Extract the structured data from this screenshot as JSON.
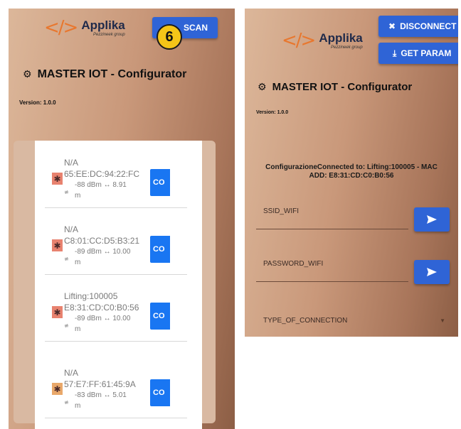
{
  "left_screen": {
    "logo": {
      "name": "Applika",
      "subtitle": "Pezzineek group"
    },
    "scan_button": "SCAN",
    "title": "MASTER IOT - Configurator",
    "version": "Version: 1.0.0",
    "badge": "6",
    "devices": [
      {
        "name": "N/A",
        "mac": "65:EE:DC:94:22:FC",
        "rssi": "-88 dBm ↔ 8.91",
        "unit": "m",
        "icon_color": "#e8826f",
        "button": "CO"
      },
      {
        "name": "N/A",
        "mac": "C8:01:CC:D5:B3:21",
        "rssi": "-89 dBm ↔ 10.00",
        "unit": "m",
        "icon_color": "#e8826f",
        "button": "CO"
      },
      {
        "name": "Lifting:100005",
        "mac": "E8:31:CD:C0:B0:56",
        "rssi": "-89 dBm ↔ 10.00",
        "unit": "m",
        "icon_color": "#e8826f",
        "button": "CO"
      },
      {
        "name": "N/A",
        "mac": "57:E7:FF:61:45:9A",
        "rssi": "-83 dBm ↔ 5.01",
        "unit": "m",
        "icon_color": "#e9a86a",
        "button": "CO"
      }
    ]
  },
  "right_screen": {
    "logo": {
      "name": "Applika",
      "subtitle": "Pezzineek group"
    },
    "disconnect_button": "DISCONNECT",
    "get_params_button": "GET PARAM",
    "title": "MASTER IOT - Configurator",
    "version": "Version: 1.0.0",
    "connection_line1": "ConfigurazioneConnected to: Lifting:100005 - MAC",
    "connection_line2": "ADD: E8:31:CD:C0:B0:56",
    "ssid_label": "SSID_WIFI",
    "password_label": "PASSWORD_WIFI",
    "connection_type_label": "TYPE_OF_CONNECTION"
  },
  "colors": {
    "accent_blue": "#2f64d6",
    "connect_blue": "#1976f2",
    "badge_yellow": "#f5c518"
  }
}
